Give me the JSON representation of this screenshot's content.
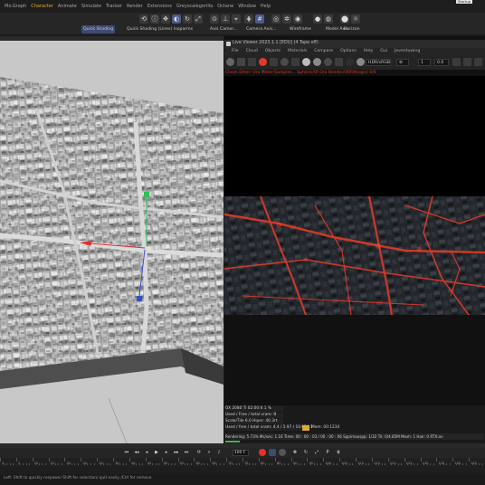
{
  "menubar": {
    "items": [
      {
        "label": "Mo.Graph",
        "highlight": false
      },
      {
        "label": "Character",
        "highlight": true
      },
      {
        "label": "Animate",
        "highlight": false
      },
      {
        "label": "Simulate",
        "highlight": false
      },
      {
        "label": "Tracker",
        "highlight": false
      },
      {
        "label": "Render",
        "highlight": false
      },
      {
        "label": "Extensions",
        "highlight": false
      },
      {
        "label": "Greyscalegorilla",
        "highlight": false
      },
      {
        "label": "Octane",
        "highlight": false
      },
      {
        "label": "Window",
        "highlight": false
      },
      {
        "label": "Help",
        "highlight": false
      }
    ],
    "right_label": "Startup"
  },
  "modebar": {
    "items": [
      {
        "label": "Quick Shading",
        "selected": true
      },
      {
        "label": "Quick Shading (Lines)",
        "selected": false
      },
      {
        "label": "Isoparms",
        "selected": false
      },
      {
        "label": "Axis Camer...",
        "selected": false
      },
      {
        "label": "Camera Axis...",
        "selected": false
      },
      {
        "label": "Wireframe",
        "selected": false
      },
      {
        "label": "Model Axis",
        "selected": false
      },
      {
        "label": "Horizon",
        "selected": false
      }
    ]
  },
  "picture_viewer": {
    "title": "Live Viewer 2023.1.1 [EDU] (4 Tape off)",
    "menu": [
      "File",
      "Cloud",
      "Objects",
      "Materials",
      "Compare",
      "Options",
      "Help",
      "Gui",
      "Jeventuwing"
    ],
    "color_space": "HDR/sRGB",
    "value_a": "1",
    "value_b": "0.0",
    "status_line": "Check Ether: Ora   Meter/Samples...   Spheric/Of Ora   Render/Of/Fitting(s) 0/0",
    "info_rows": [
      "OX 2080 Ti 02:00:6    1 %",
      "Used / Free / total vram:   B",
      "Scale/Tile  6.0    Hiper: 40.3rt",
      "Used / free / total vram: 4.4 / 5.97 / 10.074  1"
    ],
    "bottom_status": "Rendering: 5.73%   Ms/sec: 1.16   Time: 00 : 00 : 03 / 00 : 00 : 06   Spp/maxspp: 1/32   Tri: 0/4.85M   Mesh: 1   Hair: 0   RTX:on",
    "mem_label": "Mem: 00:1234"
  },
  "timeline": {
    "frame": "100 F",
    "tick_labels": [
      "0",
      "5",
      "10",
      "15",
      "20",
      "25",
      "30",
      "35",
      "40",
      "45",
      "50",
      "55",
      "60",
      "65",
      "70",
      "75",
      "80",
      "85",
      "90",
      "95",
      "100",
      "105",
      "110",
      "115",
      "120",
      "125",
      "130",
      "135",
      "140",
      "145"
    ]
  },
  "status": {
    "text": "Left: Shift to quickly respawn/ Shift for selection/ quit easily /Ctrl for remove"
  },
  "colors": {
    "accent": "#e0a82e",
    "selected_mode": "#3d4a72",
    "record": "#e03333",
    "render_glow": "#e03a2a"
  }
}
